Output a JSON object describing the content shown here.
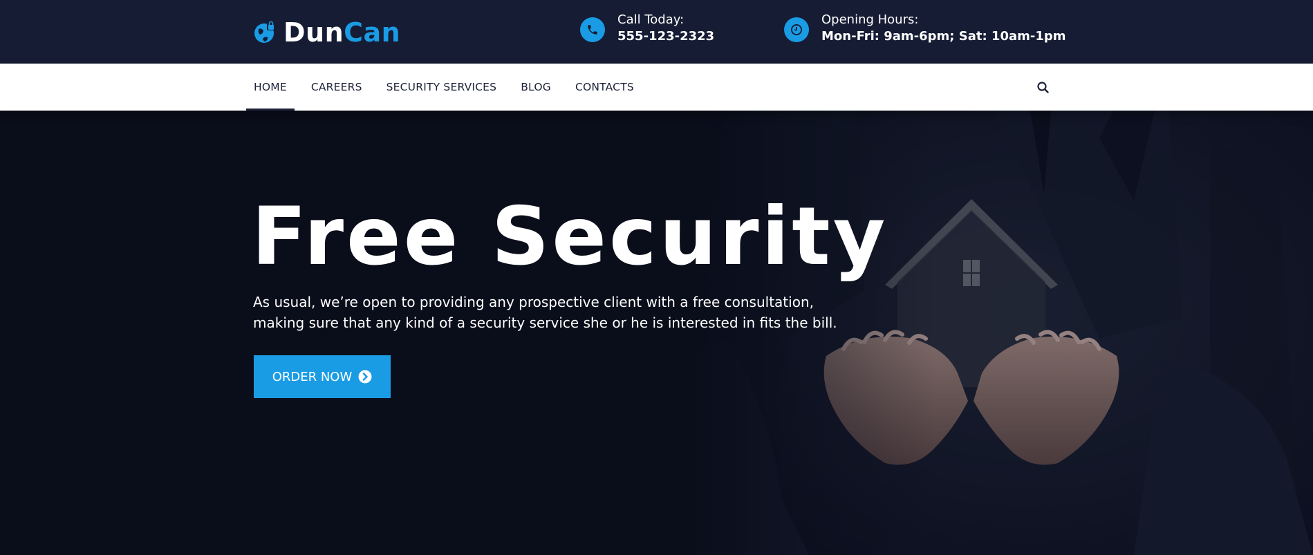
{
  "brand": {
    "name_part1": "Dun",
    "name_part2": "Can",
    "icon": "shield-globe-icon"
  },
  "topbar": {
    "call": {
      "label": "Call Today:",
      "value": "555-123-2323",
      "icon": "phone-icon"
    },
    "hours": {
      "label": "Opening Hours:",
      "value": "Mon-Fri: 9am-6pm; Sat: 10am-1pm",
      "icon": "clock-icon"
    }
  },
  "nav": {
    "items": [
      {
        "label": "HOME",
        "active": true
      },
      {
        "label": "CAREERS"
      },
      {
        "label": "SECURITY SERVICES"
      },
      {
        "label": "BLOG"
      },
      {
        "label": "CONTACTS"
      }
    ],
    "search_icon": "search-icon"
  },
  "hero": {
    "title": "Free Security",
    "description": "As usual, we’re open to providing any prospective client with a free consultation, making sure that any kind of a security service she or he is interested in fits the bill.",
    "button_label": "ORDER NOW",
    "button_icon": "chevron-circle-right-icon"
  },
  "colors": {
    "accent": "#1a9ce5",
    "topbar_bg": "#161c34",
    "hero_bg": "#0a0d1a",
    "nav_text": "#1d2238"
  }
}
